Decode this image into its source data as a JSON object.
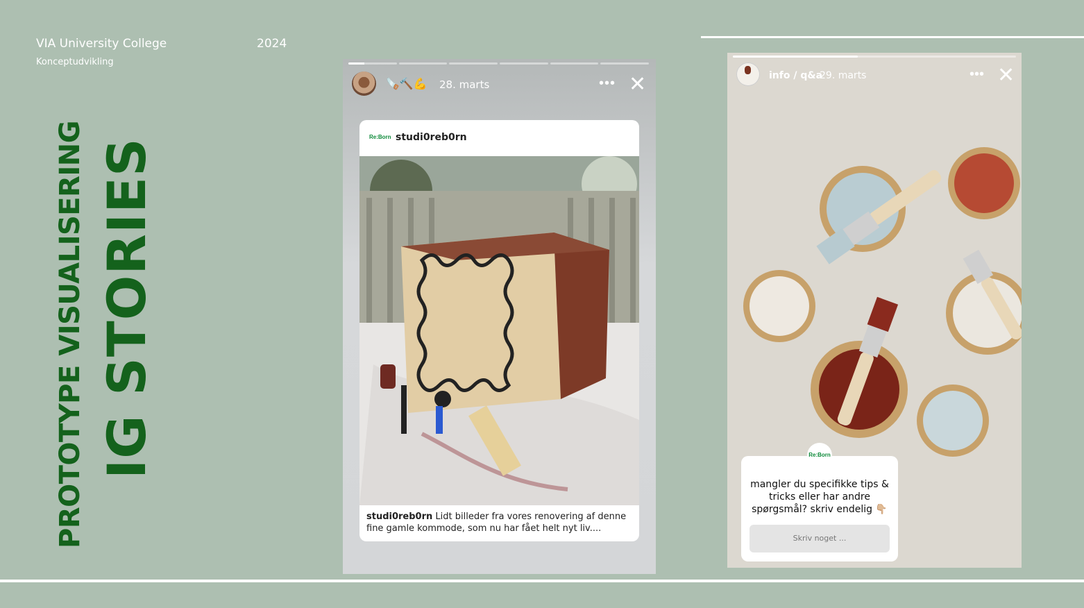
{
  "header": {
    "org": "VIA University College",
    "year": "2024",
    "subtitle": "Konceptudvikling"
  },
  "title": {
    "line1": "PROTOTYPE VISUALISERING",
    "line2": "IG STORIES"
  },
  "story1": {
    "progress_segments": 6,
    "active_segment_fill": 0.33,
    "emoji_caption": "🪚🔨💪",
    "date": "28. marts",
    "menu_label": "•••",
    "close_label": "✕",
    "post": {
      "brand_logo": "Re:Born",
      "username": "studi0reb0rn",
      "caption_user": "studi0reb0rn",
      "caption_text": " Lidt billeder fra vores renovering af denne fine gamle kommode, som nu har fået helt nyt liv...."
    }
  },
  "story2": {
    "progress_fill": 0.44,
    "username": "info / q&a",
    "date": "29. marts",
    "menu_label": "•••",
    "close_label": "✕",
    "qa": {
      "badge": "Re:Born",
      "question": "mangler du specifikke tips & tricks eller har andre spørgsmål? skriv endelig 👇🏼",
      "input_placeholder": "Skriv noget ..."
    }
  },
  "icons": [
    "close-icon",
    "more-icon",
    "avatar"
  ],
  "colors": {
    "background": "#adbfb1",
    "title_green": "#14621c",
    "brand_green": "#0e8a3a"
  }
}
